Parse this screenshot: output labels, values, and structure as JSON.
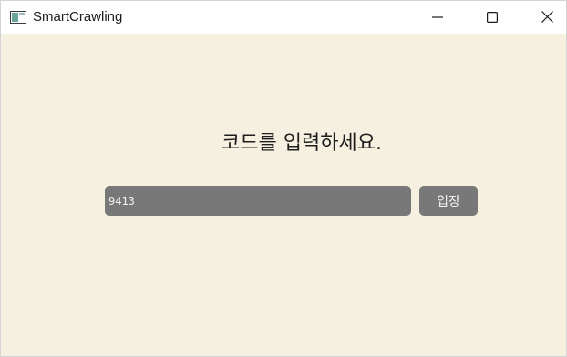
{
  "window": {
    "title": "SmartCrawling",
    "controls": [
      "minimize",
      "maximize",
      "close"
    ]
  },
  "icons": {
    "app": "app-window-icon",
    "minimize": "minimize-icon",
    "maximize": "maximize-icon",
    "close": "close-icon"
  },
  "main": {
    "prompt": "코드를 입력하세요.",
    "code_input_value": "9413",
    "enter_label": "입장"
  },
  "colors": {
    "background": "#f5f0e0",
    "control": "#787878",
    "control_text": "#f5f5f5"
  }
}
